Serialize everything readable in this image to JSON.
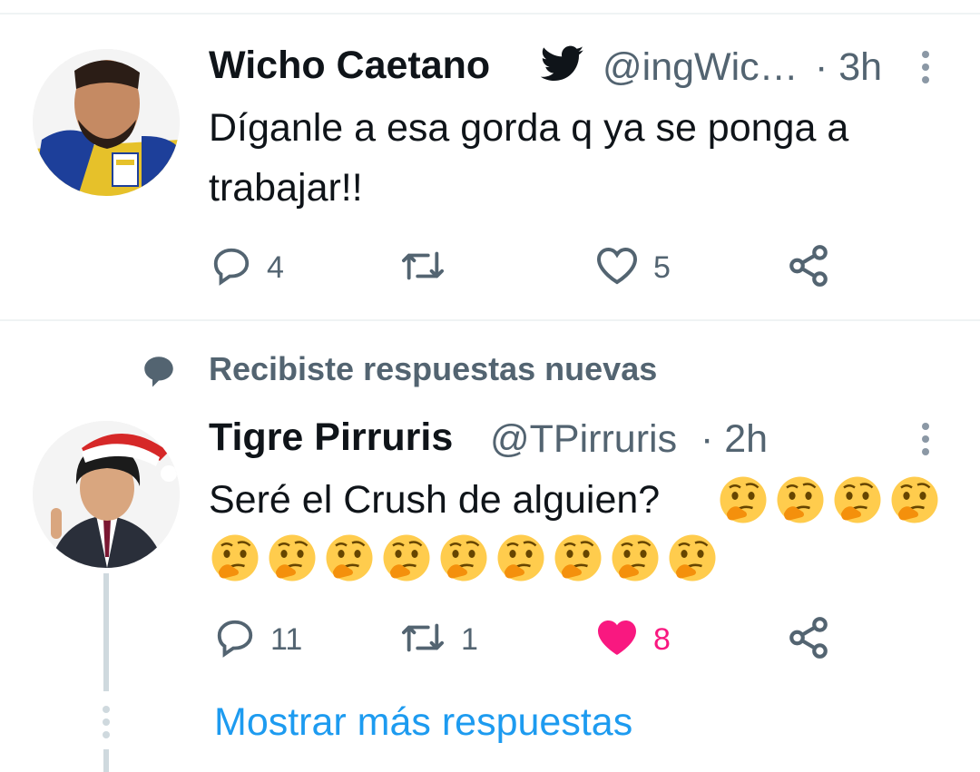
{
  "tweet1": {
    "name": "Wicho Caetano",
    "handle": "@ingWic…",
    "time": "· 3h",
    "text": "Díganle a esa gorda q ya se ponga a trabajar!!",
    "reply_count": "4",
    "retweet_count": "",
    "like_count": "5",
    "badge_icon": "twitter-bird-icon"
  },
  "social_context": {
    "icon": "speech-bubble-icon",
    "text": "Recibiste respuestas nuevas"
  },
  "tweet2": {
    "name": "Tigre Pirruris",
    "handle": "@TPirruris",
    "time": "· 2h",
    "text": "Seré el Crush de alguien?",
    "emoji": "thinking-face",
    "emoji_count": 13,
    "reply_count": "11",
    "retweet_count": "1",
    "like_count": "8",
    "liked": true
  },
  "show_more": "Mostrar más respuestas",
  "colors": {
    "accent": "#1d9bf0",
    "muted": "#536471",
    "like": "#f91880",
    "divider": "#eff3f4"
  }
}
